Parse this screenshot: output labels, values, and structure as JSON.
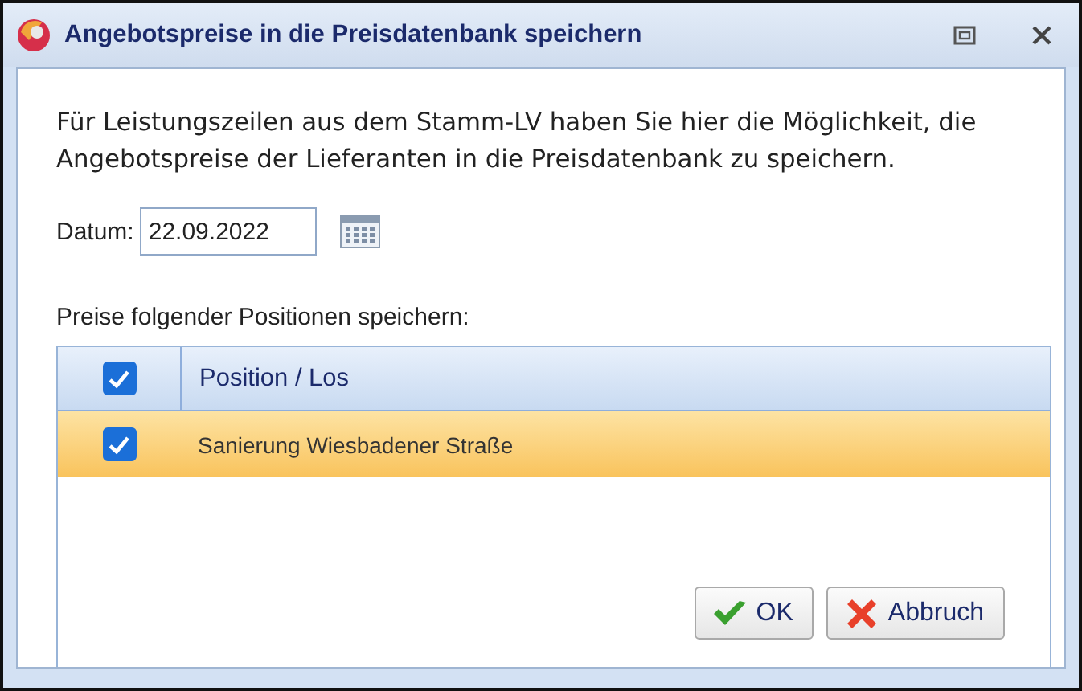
{
  "window": {
    "title": "Angebotspreise in die Preisdatenbank speichern"
  },
  "intro": "Für Leistungszeilen aus dem Stamm-LV haben Sie hier die Möglichkeit, die Angebotspreise der Lieferanten in die Preisdatenbank zu speichern.",
  "date": {
    "label": "Datum:",
    "value": "22.09.2022"
  },
  "list_label": "Preise folgender Positionen speichern:",
  "table": {
    "header_checked": true,
    "column": "Position / Los",
    "rows": [
      {
        "name": "Sanierung Wiesbadener Straße",
        "checked": true,
        "selected": true
      }
    ]
  },
  "buttons": [
    {
      "kind": "ok",
      "label": "OK"
    },
    {
      "kind": "cancel",
      "label": "Abbruch"
    }
  ]
}
